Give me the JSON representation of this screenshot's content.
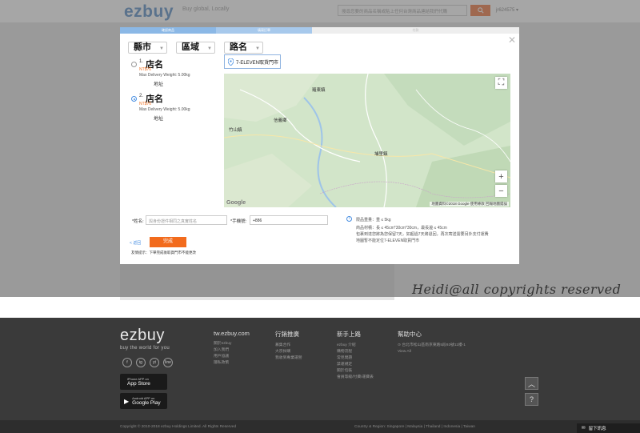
{
  "header": {
    "logo": "ezbuy",
    "slogan": "Buy global, Locally",
    "search_placeholder": "搜尋您要的商品名稱或貼上任何台灣商品連結我們代購",
    "user": "jr624575"
  },
  "modal": {
    "steps": [
      "確認商品",
      "填寫訂單",
      "付款"
    ],
    "dropdowns": [
      {
        "label": "縣市"
      },
      {
        "label": "區域"
      },
      {
        "label": "路名"
      }
    ],
    "stores": [
      {
        "num": "1.",
        "name": "店名",
        "fee": "NT$70",
        "weight": "Max Delivery Weight: 5.00kg",
        "address": "地址",
        "selected": false
      },
      {
        "num": "2.",
        "name": "店名",
        "fee": "NT$70",
        "weight": "Max Delivery Weight: 5.00kg",
        "address": "地址",
        "selected": true
      }
    ],
    "map_tag": "7-ELEVEN取貨門市",
    "map_labels": [
      {
        "name": "羅東鎮"
      },
      {
        "name": "竹山鎮"
      },
      {
        "name": "信義鄉"
      },
      {
        "name": "埔里鎮"
      }
    ],
    "map_attribution": "地圖資料©2018 Google  使用條款  回報地圖錯誤",
    "google": "Google",
    "form": {
      "name_label": "*姓名:",
      "name_placeholder": "與身份證件相同之真實姓名",
      "phone_label": "*手機號:",
      "phone_value": "+886"
    },
    "info": [
      "限品重量：重 ≤ 5kg",
      "商品材積：長 ≤ 45cm*30cm*30cm，最長邊 ≤ 45cm",
      "包裹到達您將為您保留7天，如超過7天將退回，再次寄送需要另外支付運費",
      "地圖暫不能定位7-ELEVEN取貨門市"
    ],
    "back_label": "< 返回",
    "done_label": "完成",
    "hint": "友情提示：下單完成後取貨門市不能更改"
  },
  "watermark": "Heidi@all copyrights reserved",
  "footer": {
    "logo": "ezbuy",
    "tagline": "buy the world for you",
    "social": [
      "f",
      "ig",
      "yt",
      "line"
    ],
    "apps": [
      {
        "small": "iPhone APP on",
        "big": "App Store"
      },
      {
        "small": "Android APP on",
        "big": "Google Play"
      }
    ],
    "columns": [
      {
        "title": "tw.ezbuy.com",
        "items": [
          "關於ezbuy",
          "加入我們",
          "用戶協議",
          "隱私政策"
        ]
      },
      {
        "title": "行銷推廣",
        "items": [
          "募集合作",
          "大宗採購",
          "我收到專業運營"
        ]
      },
      {
        "title": "新手上路",
        "items": [
          "ezbuy 介紹",
          "購物流程",
          "常見問題",
          "禁運規定",
          "關於包裝",
          "會員等級/付費/運費表"
        ]
      },
      {
        "title": "幫助中心",
        "items": [
          "台北市松山區南京東路5段93號11樓-1",
          "View All"
        ]
      }
    ],
    "copyright": "Copyright © 2010-2018 ezbuy Holdings Limited. All Rights Reserved",
    "region": "Country & Region: Singapore | Malaysia | Thailand | Indonesia | Taiwan",
    "message_button": "留下訊息"
  }
}
